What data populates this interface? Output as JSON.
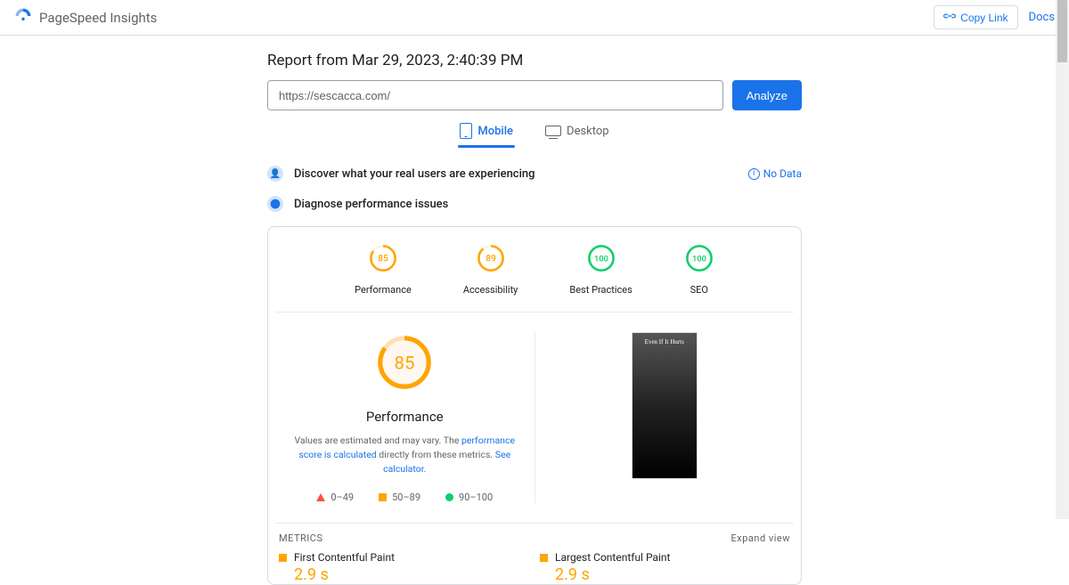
{
  "header": {
    "app_title": "PageSpeed Insights",
    "copy_link": "Copy Link",
    "docs": "Docs"
  },
  "report": {
    "title": "Report from Mar 29, 2023, 2:40:39 PM",
    "url": "https://sescacca.com/",
    "analyze_btn": "Analyze"
  },
  "tabs": {
    "mobile": "Mobile",
    "desktop": "Desktop"
  },
  "sections": {
    "discover": "Discover what your real users are experiencing",
    "nodata": "No Data",
    "diagnose": "Diagnose performance issues"
  },
  "scores": [
    {
      "value": 85,
      "label": "Performance",
      "color": "#ffa400"
    },
    {
      "value": 89,
      "label": "Accessibility",
      "color": "#ffa400"
    },
    {
      "value": 100,
      "label": "Best Practices",
      "color": "#0cce6b"
    },
    {
      "value": 100,
      "label": "SEO",
      "color": "#0cce6b"
    }
  ],
  "perf_main": {
    "value": 85,
    "title": "Performance",
    "note_pre": "Values are estimated and may vary. The ",
    "link1": "performance score is calculated",
    "note_mid": " directly from these metrics. ",
    "link2": "See calculator"
  },
  "legend": {
    "r1": "0–49",
    "r2": "50–89",
    "r3": "90–100"
  },
  "preview": {
    "caption": "Even If It Hurts"
  },
  "metrics": {
    "header": "METRICS",
    "expand": "Expand view",
    "items": [
      {
        "name": "First Contentful Paint",
        "value": "2.9 s"
      },
      {
        "name": "Largest Contentful Paint",
        "value": "2.9 s"
      }
    ]
  }
}
